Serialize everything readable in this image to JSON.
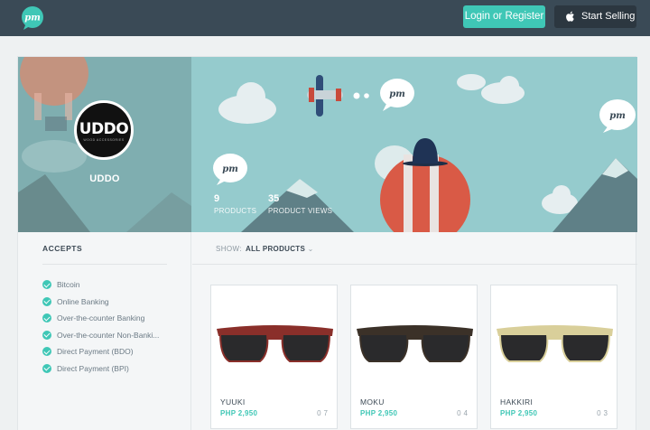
{
  "header": {
    "logo_text": "pm",
    "login_label": "Login or Register",
    "sell_label": "Start Selling"
  },
  "store": {
    "name": "UDDO",
    "avatar_text": "UDDO",
    "avatar_sub": "WOOD ACCESSORIES",
    "products_count": "9",
    "products_label": "PRODUCTS",
    "views_count": "35",
    "views_label": "PRODUCT VIEWS"
  },
  "accepts": {
    "title": "ACCEPTS",
    "items": [
      "Bitcoin",
      "Online Banking",
      "Over-the-counter Banking",
      "Over-the-counter Non-Banki...",
      "Direct Payment (BDO)",
      "Direct Payment (BPI)"
    ]
  },
  "filter": {
    "show_label": "SHOW:",
    "show_value": "ALL PRODUCTS",
    "caret": "⌄"
  },
  "products": [
    {
      "name": "YUUKI",
      "price": "PHP 2,950",
      "likes": "0",
      "comments": "7",
      "frame_color": "#8a2f2a"
    },
    {
      "name": "MOKU",
      "price": "PHP 2,950",
      "likes": "0",
      "comments": "4",
      "frame_color": "#3b3128"
    },
    {
      "name": "HAKKIRI",
      "price": "PHP 2,950",
      "likes": "0",
      "comments": "3",
      "frame_color": "#d9cf9a"
    }
  ],
  "colors": {
    "accent": "#3fc7b6",
    "topbar": "#3a4a56",
    "banner": "#95cbcd"
  }
}
